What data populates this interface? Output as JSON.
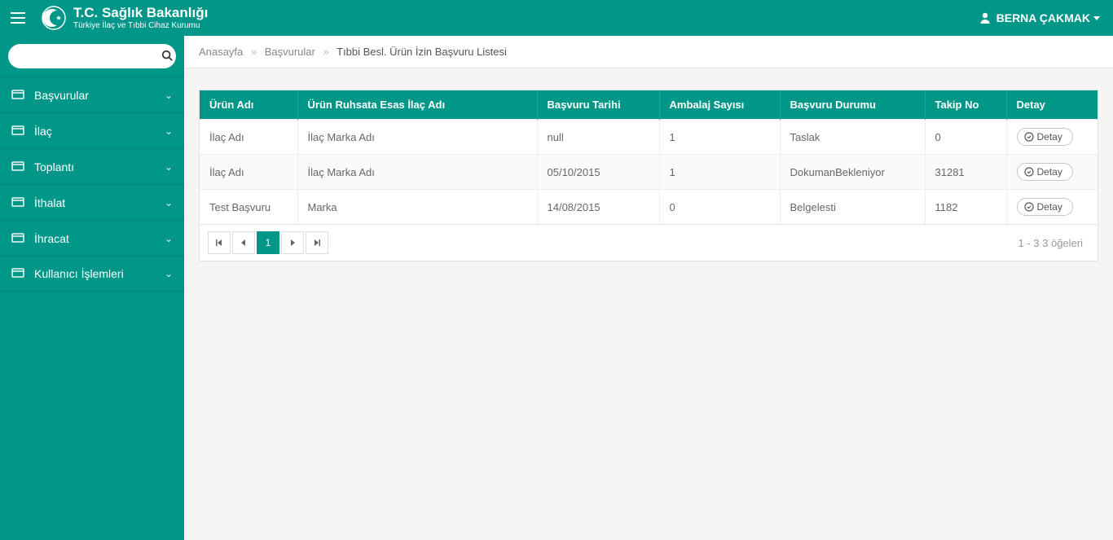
{
  "header": {
    "org_title": "T.C. Sağlık Bakanlığı",
    "org_subtitle": "Türkiye İlaç ve Tıbbi Cihaz Kurumu",
    "user_name": "BERNA ÇAKMAK"
  },
  "sidebar": {
    "search_placeholder": "",
    "items": [
      {
        "label": "Başvurular"
      },
      {
        "label": "İlaç"
      },
      {
        "label": "Toplantı"
      },
      {
        "label": "İthalat"
      },
      {
        "label": "İhracat"
      },
      {
        "label": "Kullanıcı İşlemleri"
      }
    ]
  },
  "breadcrumb": {
    "items": [
      "Anasayfa",
      "Başvurular",
      "Tıbbi Besl. Ürün İzin Başvuru Listesi"
    ]
  },
  "table": {
    "columns": [
      "Ürün Adı",
      "Ürün Ruhsata Esas İlaç Adı",
      "Başvuru Tarihi",
      "Ambalaj Sayısı",
      "Başvuru Durumu",
      "Takip No",
      "Detay"
    ],
    "detail_button_label": "Detay",
    "rows": [
      {
        "urun_adi": "İlaç Adı",
        "esas_ilac": "İlaç Marka Adı",
        "tarih": "null",
        "ambalaj": "1",
        "durum": "Taslak",
        "takip": "0"
      },
      {
        "urun_adi": "İlaç Adı",
        "esas_ilac": "İlaç Marka Adı",
        "tarih": "05/10/2015",
        "ambalaj": "1",
        "durum": "DokumanBekleniyor",
        "takip": "31281"
      },
      {
        "urun_adi": "Test Başvuru",
        "esas_ilac": "Marka",
        "tarih": "14/08/2015",
        "ambalaj": "0",
        "durum": "Belgelesti",
        "takip": "1182"
      }
    ]
  },
  "pager": {
    "current_page": "1",
    "info": "1 - 3 3 öğeleri"
  }
}
